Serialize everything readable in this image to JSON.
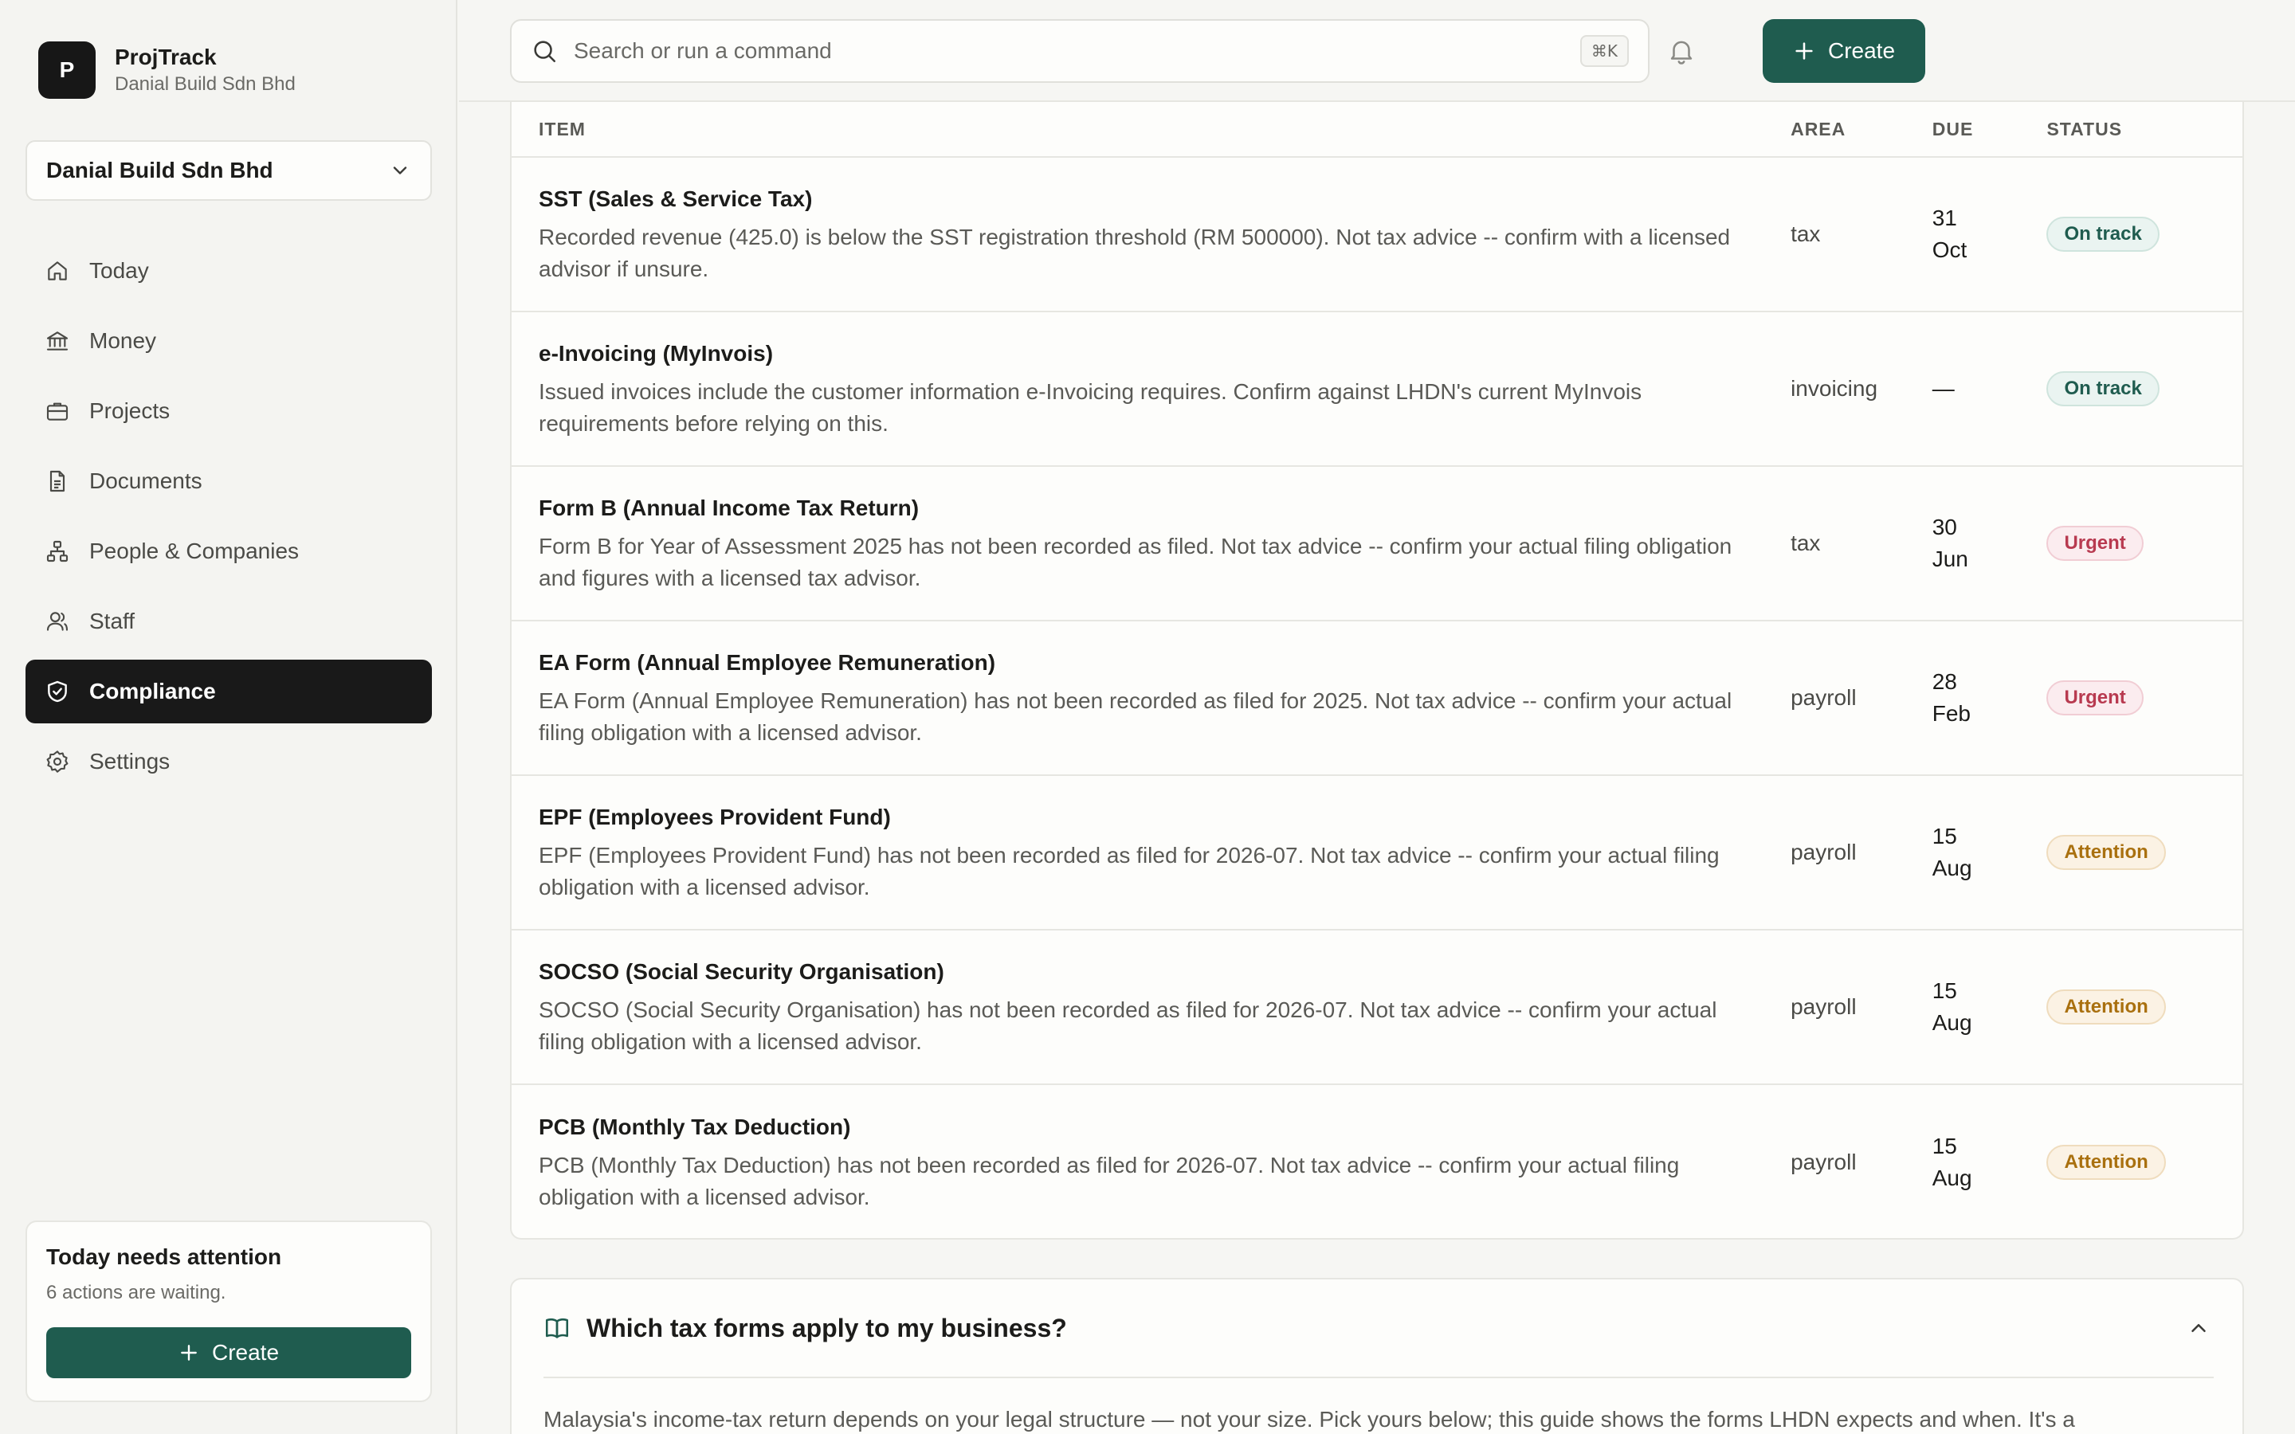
{
  "brand": {
    "initial": "P",
    "name": "ProjTrack",
    "company": "Danial Build Sdn Bhd"
  },
  "org_selector": {
    "value": "Danial Build Sdn Bhd"
  },
  "nav": [
    {
      "label": "Today",
      "icon": "home-icon",
      "active": false
    },
    {
      "label": "Money",
      "icon": "bank-icon",
      "active": false
    },
    {
      "label": "Projects",
      "icon": "briefcase-icon",
      "active": false
    },
    {
      "label": "Documents",
      "icon": "document-icon",
      "active": false
    },
    {
      "label": "People & Companies",
      "icon": "network-icon",
      "active": false
    },
    {
      "label": "Staff",
      "icon": "users-icon",
      "active": false
    },
    {
      "label": "Compliance",
      "icon": "shield-check-icon",
      "active": true
    },
    {
      "label": "Settings",
      "icon": "gear-icon",
      "active": false
    }
  ],
  "attention": {
    "title": "Today needs attention",
    "subtitle": "6 actions are waiting.",
    "button": "Create"
  },
  "topbar": {
    "search_placeholder": "Search or run a command",
    "shortcut": "⌘K",
    "create": "Create"
  },
  "table": {
    "headers": {
      "item": "ITEM",
      "area": "AREA",
      "due": "DUE",
      "status": "STATUS"
    },
    "rows": [
      {
        "title": "SST (Sales & Service Tax)",
        "description": "Recorded revenue (425.0) is below the SST registration threshold (RM 500000). Not tax advice -- confirm with a licensed advisor if unsure.",
        "area": "tax",
        "due": "31 Oct",
        "status": "On track",
        "status_kind": "ontrack"
      },
      {
        "title": "e-Invoicing (MyInvois)",
        "description": "Issued invoices include the customer information e-Invoicing requires. Confirm against LHDN's current MyInvois requirements before relying on this.",
        "area": "invoicing",
        "due": "—",
        "status": "On track",
        "status_kind": "ontrack"
      },
      {
        "title": "Form B (Annual Income Tax Return)",
        "description": "Form B for Year of Assessment 2025 has not been recorded as filed. Not tax advice -- confirm your actual filing obligation and figures with a licensed tax advisor.",
        "area": "tax",
        "due": "30 Jun",
        "status": "Urgent",
        "status_kind": "urgent"
      },
      {
        "title": "EA Form (Annual Employee Remuneration)",
        "description": "EA Form (Annual Employee Remuneration) has not been recorded as filed for 2025. Not tax advice -- confirm your actual filing obligation with a licensed advisor.",
        "area": "payroll",
        "due": "28 Feb",
        "status": "Urgent",
        "status_kind": "urgent"
      },
      {
        "title": "EPF (Employees Provident Fund)",
        "description": "EPF (Employees Provident Fund) has not been recorded as filed for 2026-07. Not tax advice -- confirm your actual filing obligation with a licensed advisor.",
        "area": "payroll",
        "due": "15 Aug",
        "status": "Attention",
        "status_kind": "attention"
      },
      {
        "title": "SOCSO (Social Security Organisation)",
        "description": "SOCSO (Social Security Organisation) has not been recorded as filed for 2026-07. Not tax advice -- confirm your actual filing obligation with a licensed advisor.",
        "area": "payroll",
        "due": "15 Aug",
        "status": "Attention",
        "status_kind": "attention"
      },
      {
        "title": "PCB (Monthly Tax Deduction)",
        "description": "PCB (Monthly Tax Deduction) has not been recorded as filed for 2026-07. Not tax advice -- confirm your actual filing obligation with a licensed advisor.",
        "area": "payroll",
        "due": "15 Aug",
        "status": "Attention",
        "status_kind": "attention"
      }
    ]
  },
  "guide": {
    "title": "Which tax forms apply to my business?",
    "body": "Malaysia's income-tax return depends on your legal structure — not your size. Pick yours below; this guide shows the forms LHDN expects and when. It's a"
  },
  "colors": {
    "accent": "#1f5c4f",
    "sidebar_active": "#191919",
    "ontrack": "#1f5c4f",
    "urgent": "#b83a50",
    "attention": "#a9700f"
  }
}
